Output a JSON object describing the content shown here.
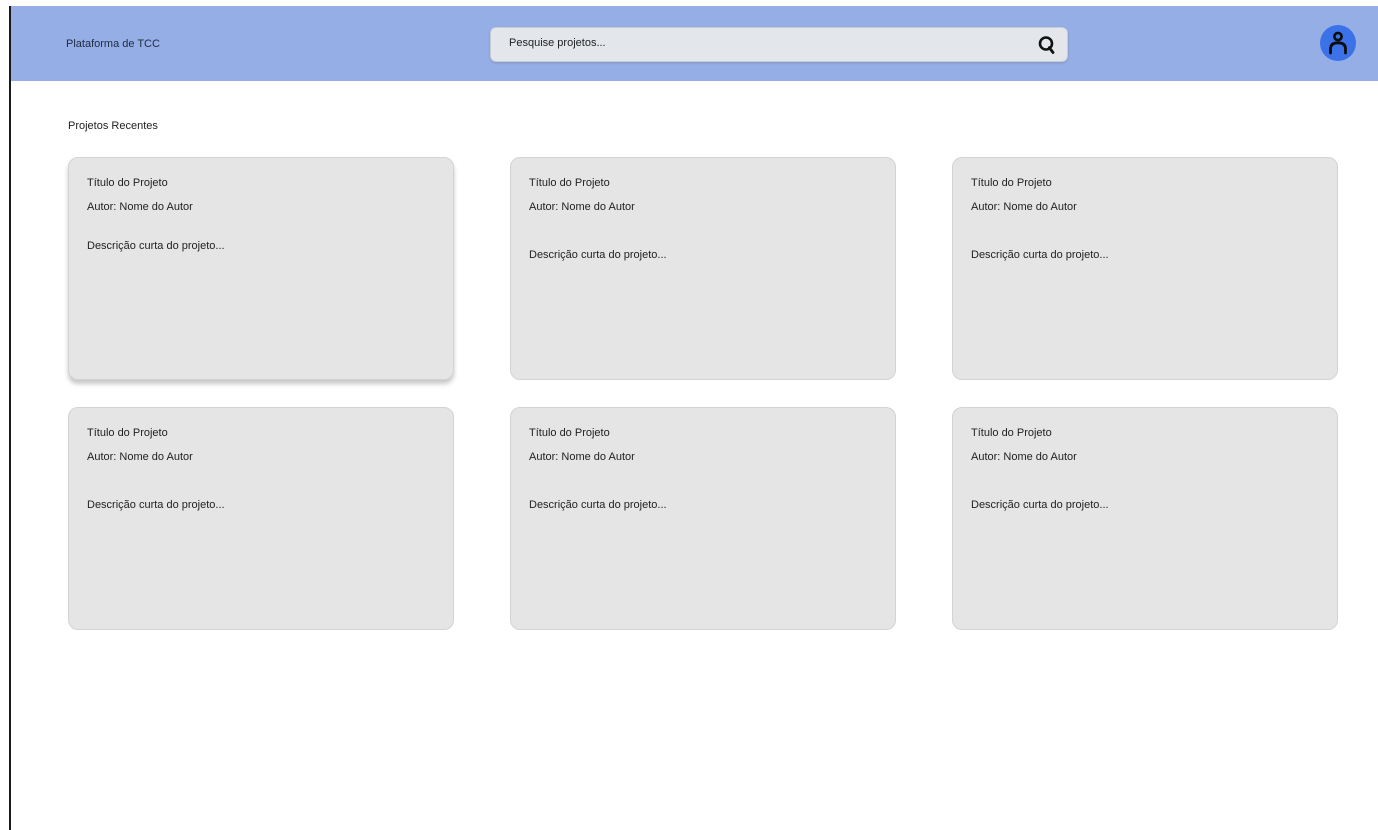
{
  "header": {
    "app_title": "Plataforma de TCC",
    "search": {
      "placeholder": "Pesquise projetos...",
      "value": ""
    },
    "search_icon": "search-icon",
    "profile_icon": "user-icon",
    "colors": {
      "bar": "#95aee6",
      "avatar": "#3b72e8"
    }
  },
  "main": {
    "section_title": "Projetos Recentes",
    "projects": [
      {
        "title": "Título do Projeto",
        "author": "Autor: Nome do Autor",
        "description": "Descrição curta do projeto..."
      },
      {
        "title": "Título do Projeto",
        "author": "Autor: Nome do Autor",
        "description": "Descrição curta do projeto..."
      },
      {
        "title": "Título do Projeto",
        "author": "Autor: Nome do Autor",
        "description": "Descrição curta do projeto..."
      },
      {
        "title": "Título do Projeto",
        "author": "Autor: Nome do Autor",
        "description": "Descrição curta do projeto..."
      },
      {
        "title": "Título do Projeto",
        "author": "Autor: Nome do Autor",
        "description": "Descrição curta do projeto..."
      },
      {
        "title": "Título do Projeto",
        "author": "Autor: Nome do Autor",
        "description": "Descrição curta do projeto..."
      }
    ]
  }
}
